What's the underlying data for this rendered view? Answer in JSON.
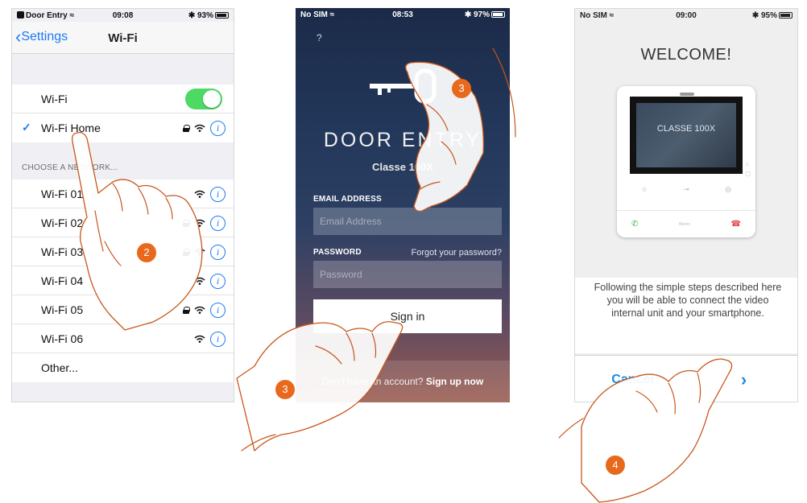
{
  "screen1": {
    "status": {
      "carrier": "Door Entry",
      "time": "09:08",
      "battery": "93%"
    },
    "nav": {
      "back_label": "Settings",
      "title": "Wi-Fi"
    },
    "wifi_toggle": {
      "label": "Wi-Fi",
      "state": "on"
    },
    "connected_network": "Wi-Fi Home",
    "section_header": "CHOOSE A NETWORK...",
    "networks": [
      {
        "name": "Wi-Fi 01",
        "locked": false
      },
      {
        "name": "Wi-Fi 02",
        "locked": true
      },
      {
        "name": "Wi-Fi 03",
        "locked": true
      },
      {
        "name": "Wi-Fi 04",
        "locked": false
      },
      {
        "name": "Wi-Fi 05",
        "locked": true
      },
      {
        "name": "Wi-Fi 06",
        "locked": false
      }
    ],
    "other_label": "Other...",
    "info_glyph": "i",
    "step_badge": "2"
  },
  "screen2": {
    "status": {
      "carrier": "No SIM",
      "time": "08:53",
      "battery": "97%"
    },
    "help": "?",
    "title": "DOOR ENTRY",
    "subtitle": "Classe 100X",
    "email_label": "EMAIL ADDRESS",
    "email_placeholder": "Email Address",
    "password_label": "PASSWORD",
    "password_placeholder": "Password",
    "forgot": "Forgot your password?",
    "signin": "Sign in",
    "footer_prefix": "Don't have an account?",
    "footer_link": "Sign up now",
    "step_badges": [
      "3",
      "3"
    ]
  },
  "screen3": {
    "status": {
      "carrier": "No SIM",
      "time": "09:00",
      "battery": "95%"
    },
    "welcome": "WELCOME!",
    "device_screen_label": "CLASSE 100X",
    "device_bar_label": "Memo",
    "description": "Following the simple steps described here you will be able to connect the video internal unit and your smartphone.",
    "cancel": "Cancel",
    "next": "›",
    "step_badge": "4"
  },
  "colors": {
    "ios_blue": "#1a7bf5",
    "toggle_green": "#4cd964",
    "badge_orange": "#e8681c",
    "button_blue": "#1a8ce3"
  }
}
